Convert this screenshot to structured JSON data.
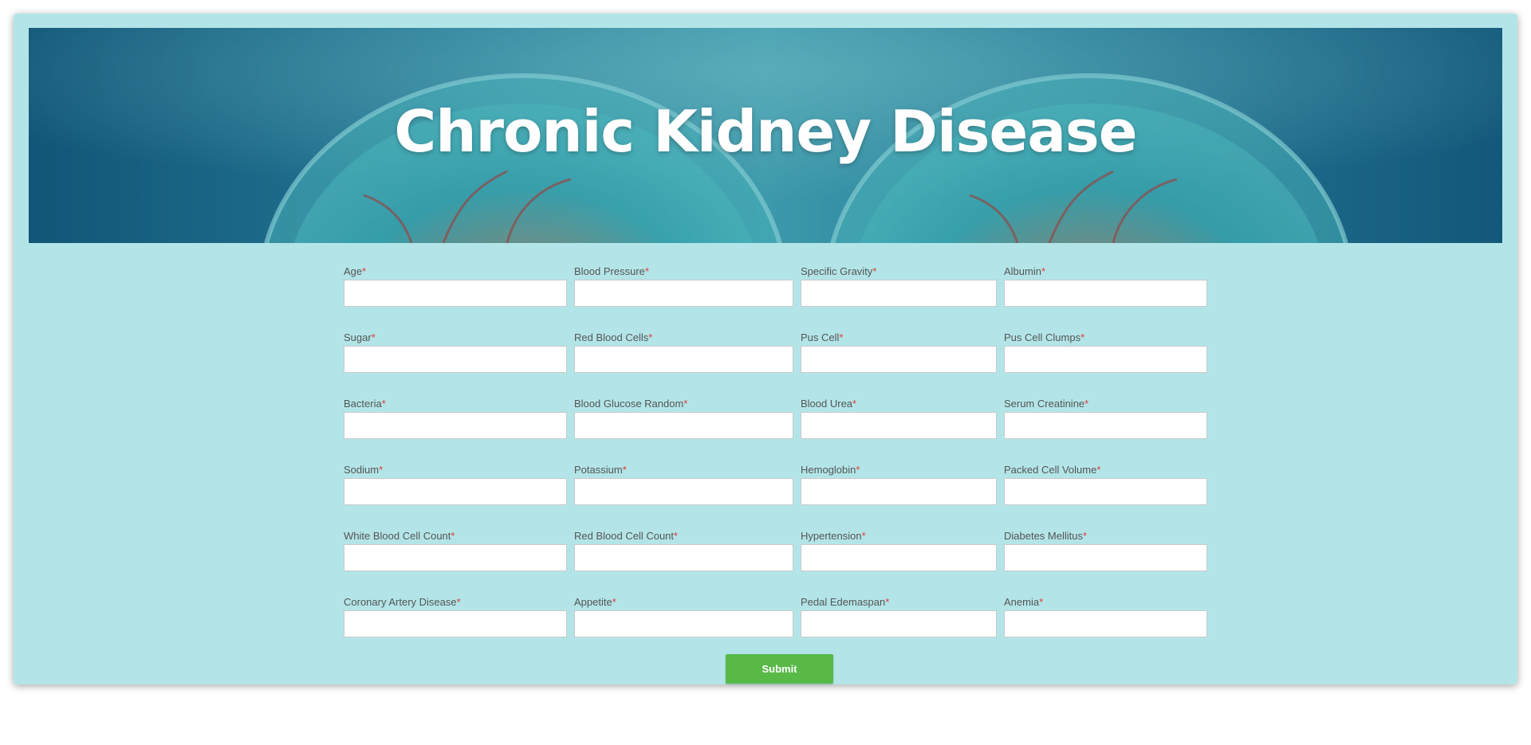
{
  "banner": {
    "title": "Chronic Kidney Disease"
  },
  "form": {
    "required_marker": "*",
    "rows": [
      [
        {
          "label": "Age",
          "value": "",
          "placeholder": ""
        },
        {
          "label": "Blood Pressure",
          "value": "",
          "placeholder": ""
        },
        {
          "label": "Specific Gravity",
          "value": "",
          "placeholder": ""
        },
        {
          "label": "Albumin",
          "value": "",
          "placeholder": ""
        }
      ],
      [
        {
          "label": "Sugar",
          "value": "",
          "placeholder": ""
        },
        {
          "label": "Red Blood Cells",
          "value": "",
          "placeholder": ""
        },
        {
          "label": "Pus Cell",
          "value": "",
          "placeholder": ""
        },
        {
          "label": "Pus Cell Clumps",
          "value": "",
          "placeholder": ""
        }
      ],
      [
        {
          "label": "Bacteria",
          "value": "",
          "placeholder": ""
        },
        {
          "label": "Blood Glucose Random",
          "value": "",
          "placeholder": ""
        },
        {
          "label": "Blood Urea",
          "value": "",
          "placeholder": ""
        },
        {
          "label": "Serum Creatinine",
          "value": "",
          "placeholder": ""
        }
      ],
      [
        {
          "label": "Sodium",
          "value": "",
          "placeholder": ""
        },
        {
          "label": "Potassium",
          "value": "",
          "placeholder": ""
        },
        {
          "label": "Hemoglobin",
          "value": "",
          "placeholder": ""
        },
        {
          "label": "Packed Cell Volume",
          "value": "",
          "placeholder": ""
        }
      ],
      [
        {
          "label": "White Blood Cell Count",
          "value": "",
          "placeholder": ""
        },
        {
          "label": "Red Blood Cell Count",
          "value": "",
          "placeholder": ""
        },
        {
          "label": "Hypertension",
          "value": "",
          "placeholder": ""
        },
        {
          "label": "Diabetes Mellitus",
          "value": "",
          "placeholder": ""
        }
      ],
      [
        {
          "label": "Coronary Artery Disease",
          "value": "",
          "placeholder": ""
        },
        {
          "label": "Appetite",
          "value": "",
          "placeholder": ""
        },
        {
          "label": "Pedal Edemaspan",
          "value": "",
          "placeholder": ""
        },
        {
          "label": "Anemia",
          "value": "",
          "placeholder": ""
        }
      ]
    ],
    "submit_label": "Submit"
  },
  "colors": {
    "card_background": "#b3e5e8",
    "required_marker": "#e53935",
    "submit_button": "#58b947",
    "banner_dark": "#0f4c6e"
  }
}
